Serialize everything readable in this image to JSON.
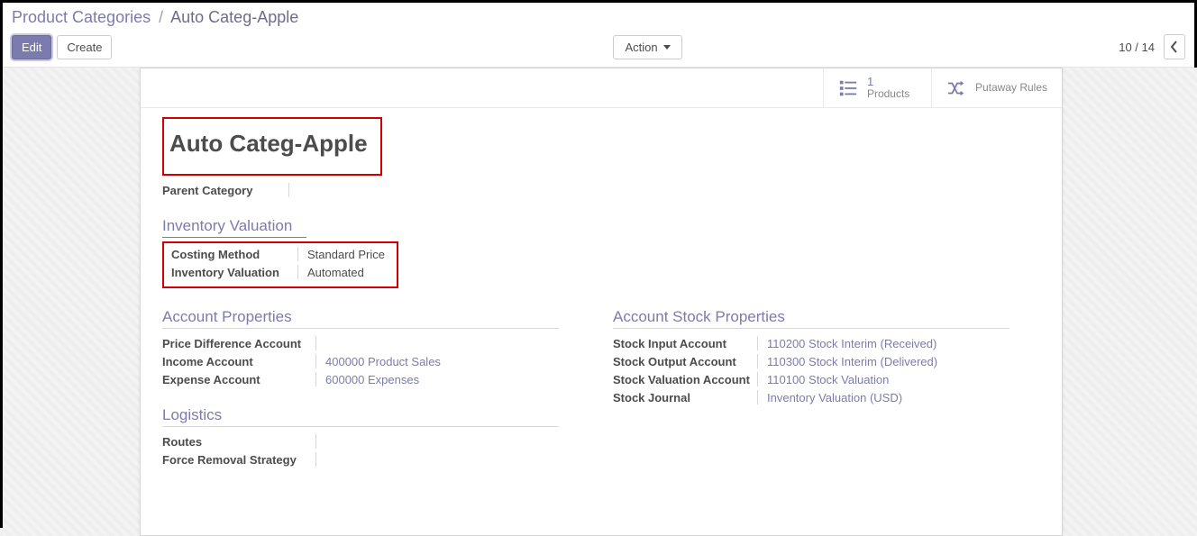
{
  "breadcrumb": {
    "parent": "Product Categories",
    "current": "Auto Categ-Apple"
  },
  "toolbar": {
    "edit_label": "Edit",
    "create_label": "Create",
    "action_label": "Action"
  },
  "pager": {
    "position": "10 / 14"
  },
  "button_box": {
    "products_count": "1",
    "products_label": "Products",
    "putaway_label": "Putaway Rules"
  },
  "record": {
    "title": "Auto Categ-Apple",
    "parent_category_label": "Parent Category",
    "parent_category_value": ""
  },
  "inventory_valuation": {
    "section_title": "Inventory Valuation",
    "costing_method_label": "Costing Method",
    "costing_method_value": "Standard Price",
    "inventory_valuation_label": "Inventory Valuation",
    "inventory_valuation_value": "Automated"
  },
  "account_properties": {
    "section_title": "Account Properties",
    "price_diff_label": "Price Difference Account",
    "price_diff_value": "",
    "income_label": "Income Account",
    "income_value": "400000 Product Sales",
    "expense_label": "Expense Account",
    "expense_value": "600000 Expenses"
  },
  "account_stock_properties": {
    "section_title": "Account Stock Properties",
    "stock_input_label": "Stock Input Account",
    "stock_input_value": "110200 Stock Interim (Received)",
    "stock_output_label": "Stock Output Account",
    "stock_output_value": "110300 Stock Interim (Delivered)",
    "stock_valuation_label": "Stock Valuation Account",
    "stock_valuation_value": "110100 Stock Valuation",
    "stock_journal_label": "Stock Journal",
    "stock_journal_value": "Inventory Valuation (USD)"
  },
  "logistics": {
    "section_title": "Logistics",
    "routes_label": "Routes",
    "force_removal_label": "Force Removal Strategy"
  }
}
